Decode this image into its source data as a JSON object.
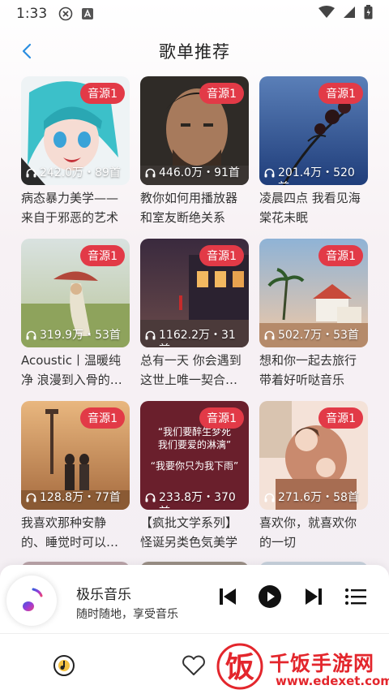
{
  "status_bar": {
    "time": "1:33"
  },
  "header": {
    "title": "歌单推荐"
  },
  "playlists": [
    {
      "badge": "音源1",
      "plays": "242.0万・89首",
      "title": "病态暴力美学——来自于邪恶的艺术"
    },
    {
      "badge": "音源1",
      "plays": "446.0万・91首",
      "title": "教你如何用播放器和室友断绝关系"
    },
    {
      "badge": "音源1",
      "plays": "201.4万・520首",
      "title": "凌晨四点 我看见海棠花未眠"
    },
    {
      "badge": "音源1",
      "plays": "319.9万・53首",
      "title": "Acoustic丨温暖纯净 浪漫到入骨的…"
    },
    {
      "badge": "音源1",
      "plays": "1162.2万・31首",
      "title": "总有一天 你会遇到这世上唯一契合…"
    },
    {
      "badge": "音源1",
      "plays": "502.7万・53首",
      "title": "想和你一起去旅行带着好听哒音乐"
    },
    {
      "badge": "音源1",
      "plays": "128.8万・77首",
      "title": "我喜欢那种安静的、睡觉时可以…"
    },
    {
      "badge": "音源1",
      "plays": "233.8万・370首",
      "title": "【疯批文学系列】怪诞另类色気美学"
    },
    {
      "badge": "音源1",
      "plays": "271.6万・58首",
      "title": "喜欢你，就喜欢你的一切"
    }
  ],
  "cover_text": {
    "line1": "“我们要醉生梦死",
    "line2": "我们要爱的淋漓”",
    "line3": "“我要你只为我下雨”"
  },
  "player": {
    "name": "极乐音乐",
    "subtitle": "随时随地，享受音乐"
  },
  "watermark": {
    "text": "千饭手游网",
    "url": "www.edexet.com",
    "logo_char": "饭"
  },
  "colors": {
    "badge": "#e23a47",
    "accent": "#2b8ee0"
  }
}
